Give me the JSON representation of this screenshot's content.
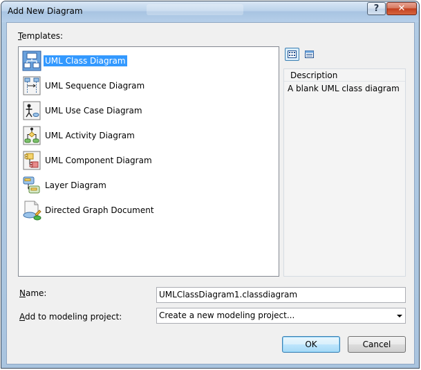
{
  "window": {
    "title": "Add New Diagram",
    "help": "?",
    "close": "✕"
  },
  "templates": {
    "label": "Templates:",
    "label_access": "T",
    "label_rest": "emplates:",
    "items": [
      {
        "label": "UML Class Diagram",
        "icon": "uml-class-diagram-icon",
        "selected": true
      },
      {
        "label": "UML Sequence Diagram",
        "icon": "uml-sequence-diagram-icon"
      },
      {
        "label": "UML Use Case Diagram",
        "icon": "uml-use-case-diagram-icon"
      },
      {
        "label": "UML Activity Diagram",
        "icon": "uml-activity-diagram-icon"
      },
      {
        "label": "UML Component Diagram",
        "icon": "uml-component-diagram-icon"
      },
      {
        "label": "Layer Diagram",
        "icon": "layer-diagram-icon"
      },
      {
        "label": "Directed Graph Document",
        "icon": "directed-graph-icon"
      }
    ]
  },
  "description": {
    "title": "Description",
    "text": "A blank UML class diagram"
  },
  "name": {
    "label_access": "N",
    "label_rest": "ame:",
    "value": "UMLClassDiagram1.classdiagram"
  },
  "project": {
    "label_access": "A",
    "label_rest": "dd to modeling project:",
    "value": "Create a new modeling project..."
  },
  "buttons": {
    "ok": "OK",
    "cancel": "Cancel"
  },
  "colors": {
    "selection": "#3399ff",
    "accent": "#3c7fb1"
  }
}
